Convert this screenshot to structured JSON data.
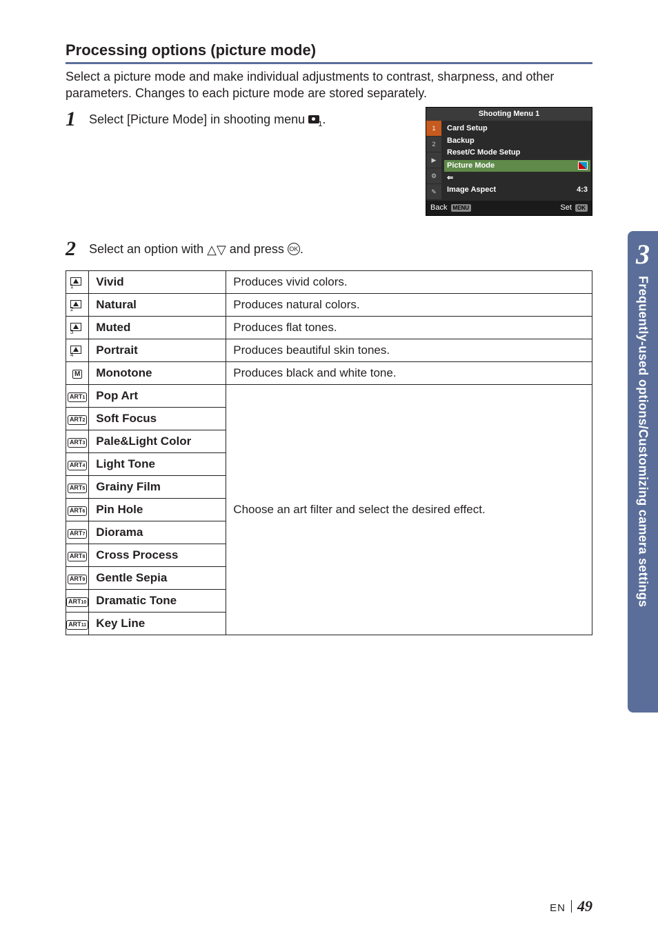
{
  "section_title": "Processing options (picture mode)",
  "intro": "Select a picture mode and make individual adjustments to contrast, sharpness, and other parameters. Changes to each picture mode are stored separately.",
  "step1": {
    "text_before": "Select [Picture Mode] in shooting menu ",
    "menu_sub": "1",
    "text_after": "."
  },
  "step2": {
    "text_before": "Select an option with ",
    "triangles": "△▽",
    "text_mid": " and press ",
    "ok_label": "OK",
    "text_after": "."
  },
  "menu": {
    "title": "Shooting Menu 1",
    "tabs": [
      "1",
      "2",
      "▶",
      "⚙",
      "✎"
    ],
    "items_plain": [
      "Card Setup",
      "Backup",
      "Reset/C Mode Setup"
    ],
    "highlight": "Picture Mode",
    "exposure_row": "⇐",
    "aspect_label": "Image Aspect",
    "aspect_value": "4:3",
    "back": "Back",
    "back_tag": "MENU",
    "set": "Set",
    "set_tag": "OK"
  },
  "table": [
    {
      "icon_type": "tone",
      "sub": "1",
      "label": "Vivid",
      "desc": "Produces vivid colors.",
      "row": "single"
    },
    {
      "icon_type": "tone",
      "sub": "2",
      "label": "Natural",
      "desc": "Produces natural colors.",
      "row": "single"
    },
    {
      "icon_type": "tone",
      "sub": "3",
      "label": "Muted",
      "desc": "Produces flat tones.",
      "row": "single"
    },
    {
      "icon_type": "tone",
      "sub": "4",
      "label": "Portrait",
      "desc": "Produces beautiful skin tones.",
      "row": "single"
    },
    {
      "icon_type": "m",
      "sub": "",
      "label": "Monotone",
      "desc": "Produces black and white tone.",
      "row": "single"
    },
    {
      "icon_type": "art",
      "sub": "1",
      "label": "Pop Art",
      "row": "group-start"
    },
    {
      "icon_type": "art",
      "sub": "2",
      "label": "Soft Focus",
      "row": "group"
    },
    {
      "icon_type": "art",
      "sub": "3",
      "label": "Pale&Light Color",
      "row": "group"
    },
    {
      "icon_type": "art",
      "sub": "4",
      "label": "Light Tone",
      "row": "group"
    },
    {
      "icon_type": "art",
      "sub": "5",
      "label": "Grainy Film",
      "row": "group"
    },
    {
      "icon_type": "art",
      "sub": "6",
      "label": "Pin Hole",
      "row": "group"
    },
    {
      "icon_type": "art",
      "sub": "7",
      "label": "Diorama",
      "row": "group"
    },
    {
      "icon_type": "art",
      "sub": "8",
      "label": "Cross Process",
      "row": "group"
    },
    {
      "icon_type": "art",
      "sub": "9",
      "label": "Gentle Sepia",
      "row": "group"
    },
    {
      "icon_type": "art",
      "sub": "10",
      "label": "Dramatic Tone",
      "row": "group"
    },
    {
      "icon_type": "art",
      "sub": "11",
      "label": "Key Line",
      "row": "group-end"
    }
  ],
  "group_desc": "Choose an art filter and select the desired effect.",
  "side": {
    "chapter": "3",
    "text": "Frequently-used options/Customizing camera settings"
  },
  "footer": {
    "lang": "EN",
    "page": "49"
  }
}
